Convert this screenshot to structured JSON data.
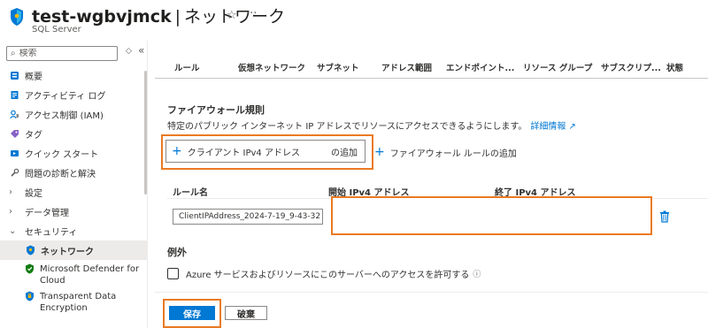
{
  "header": {
    "resource_name": "test-wgbvjmck",
    "separator": "|",
    "page_name": "ネットワーク",
    "resource_type": "SQL Server",
    "star_glyph": "☆",
    "more_glyph": "···"
  },
  "sidebar": {
    "search_placeholder": "検索",
    "collapse_small": "◇",
    "collapse_glyph": "«",
    "items": [
      {
        "label": "概要",
        "icon": "sql-server-icon",
        "color": "#0078d4"
      },
      {
        "label": "アクティビティ ログ",
        "icon": "activity-log-icon",
        "color": "#0078d4"
      },
      {
        "label": "アクセス制御 (IAM)",
        "icon": "iam-icon",
        "color": "#0078d4"
      },
      {
        "label": "タグ",
        "icon": "tag-icon",
        "color": "#8661c5"
      },
      {
        "label": "クイック スタート",
        "icon": "quickstart-icon",
        "color": "#0078d4"
      },
      {
        "label": "問題の診断と解決",
        "icon": "wrench-icon",
        "color": "#605e5c"
      },
      {
        "label": "設定",
        "icon": "chevron-right-icon",
        "expander": "›"
      },
      {
        "label": "データ管理",
        "icon": "chevron-right-icon",
        "expander": "›"
      },
      {
        "label": "セキュリティ",
        "icon": "chevron-down-icon",
        "expander": "⌄"
      },
      {
        "label": "ネットワーク",
        "icon": "shield-icon",
        "color": "#0078d4",
        "selected": true
      },
      {
        "label": "Microsoft Defender for Cloud",
        "icon": "defender-icon",
        "color": "#107c10"
      },
      {
        "label": "Transparent Data Encryption",
        "icon": "tde-icon",
        "color": "#0078d4"
      }
    ]
  },
  "vnet_table": {
    "headers": [
      "ルール",
      "仮想ネットワーク",
      "サブネット",
      "アドレス範囲",
      "エンドポイント...",
      "リソース グループ",
      "サブスクリプ...",
      "状態"
    ]
  },
  "firewall": {
    "title": "ファイアウォール規則",
    "description": "特定のパブリック インターネット IP アドレスでリソースにアクセスできるようにします。",
    "learn_more": "詳細情報",
    "add_client_prefix": "クライアント IPv4 アドレス",
    "add_client_suffix": "の追加",
    "add_rule_label": "ファイアウォール ルールの追加",
    "columns": {
      "rule_name": "ルール名",
      "start_ip": "開始 IPv4 アドレス",
      "end_ip": "終了 IPv4 アドレス"
    },
    "rule": {
      "name": "ClientIPAddress_2024-7-19_9-43-32"
    }
  },
  "exceptions": {
    "title": "例外",
    "allow_azure_label": "Azure サービスおよびリソースにこのサーバーへのアクセスを許可する"
  },
  "footer": {
    "save_label": "保存",
    "discard_label": "破棄"
  },
  "colors": {
    "accent": "#0078d4",
    "highlight": "#ea7a23"
  }
}
